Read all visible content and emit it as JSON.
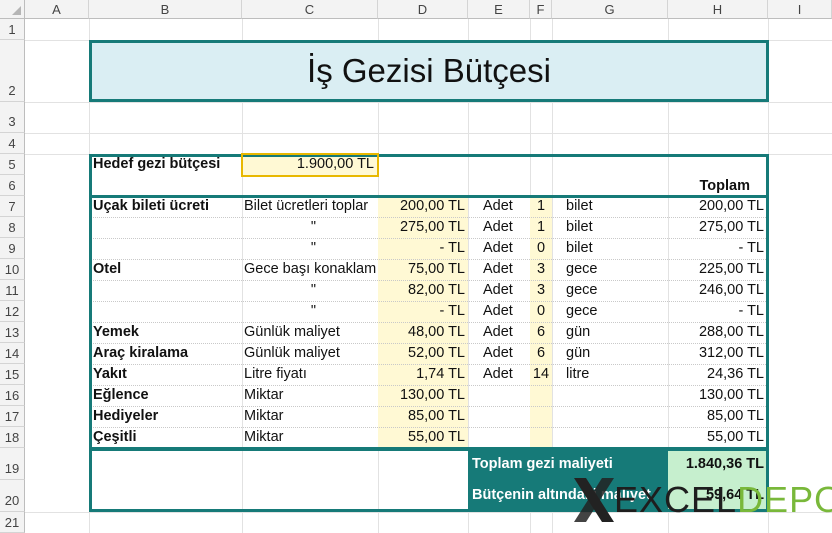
{
  "columns": [
    "A",
    "B",
    "C",
    "D",
    "E",
    "F",
    "G",
    "H",
    "I"
  ],
  "rows": [
    "1",
    "2",
    "3",
    "4",
    "5",
    "6",
    "7",
    "8",
    "9",
    "10",
    "11",
    "12",
    "13",
    "14",
    "15",
    "16",
    "17",
    "18",
    "19",
    "20",
    "21"
  ],
  "title": "İş Gezisi Bütçesi",
  "target": {
    "label": "Hedef gezi bütçesi",
    "value": "1.900,00 TL"
  },
  "total_header": "Toplam",
  "items": [
    {
      "name": "Uçak bileti ücreti",
      "desc": "Bilet ücretleri toplar",
      "price": "200,00 TL",
      "unit_word": "Adet",
      "qty": "1",
      "unit": "bilet",
      "total": "200,00 TL"
    },
    {
      "name": "",
      "desc": "\"",
      "price": "275,00 TL",
      "unit_word": "Adet",
      "qty": "1",
      "unit": "bilet",
      "total": "275,00 TL"
    },
    {
      "name": "",
      "desc": "\"",
      "price": "-    TL",
      "unit_word": "Adet",
      "qty": "0",
      "unit": "bilet",
      "total": "-    TL"
    },
    {
      "name": "Otel",
      "desc": "Gece başı konaklam",
      "price": "75,00 TL",
      "unit_word": "Adet",
      "qty": "3",
      "unit": "gece",
      "total": "225,00 TL"
    },
    {
      "name": "",
      "desc": "\"",
      "price": "82,00 TL",
      "unit_word": "Adet",
      "qty": "3",
      "unit": "gece",
      "total": "246,00 TL"
    },
    {
      "name": "",
      "desc": "\"",
      "price": "-    TL",
      "unit_word": "Adet",
      "qty": "0",
      "unit": "gece",
      "total": "-    TL"
    },
    {
      "name": "Yemek",
      "desc": "Günlük maliyet",
      "price": "48,00 TL",
      "unit_word": "Adet",
      "qty": "6",
      "unit": "gün",
      "total": "288,00 TL"
    },
    {
      "name": "Araç kiralama",
      "desc": "Günlük maliyet",
      "price": "52,00 TL",
      "unit_word": "Adet",
      "qty": "6",
      "unit": "gün",
      "total": "312,00 TL"
    },
    {
      "name": "Yakıt",
      "desc": "Litre fiyatı",
      "price": "1,74 TL",
      "unit_word": "Adet",
      "qty": "14",
      "unit": "litre",
      "total": "24,36 TL"
    },
    {
      "name": "Eğlence",
      "desc": "Miktar",
      "price": "130,00 TL",
      "unit_word": "",
      "qty": "",
      "unit": "",
      "total": "130,00 TL"
    },
    {
      "name": "Hediyeler",
      "desc": "Miktar",
      "price": "85,00 TL",
      "unit_word": "",
      "qty": "",
      "unit": "",
      "total": "85,00 TL"
    },
    {
      "name": "Çeşitli",
      "desc": "Miktar",
      "price": "55,00 TL",
      "unit_word": "",
      "qty": "",
      "unit": "",
      "total": "55,00 TL"
    }
  ],
  "summary": {
    "total_label": "Toplam gezi maliyeti",
    "total_value": "1.840,36 TL",
    "under_label": "Bütçenin altındaki maliyet",
    "under_value": "59,64 TL"
  },
  "watermark": {
    "part1": "EXCEL",
    "part2": "DEPO"
  },
  "colors": {
    "teal": "#167a78",
    "light_yellow": "#fff9d4",
    "light_green": "#c6efce",
    "title_fill": "#daeef3",
    "selection": "#e8b800"
  }
}
